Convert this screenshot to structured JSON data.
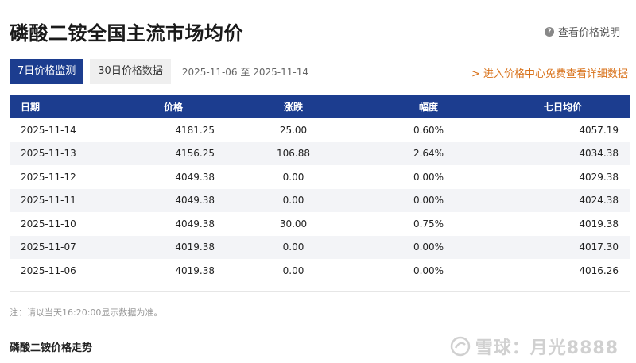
{
  "page": {
    "title": "磷酸二铵全国主流市场均价",
    "help_label": "查看价格说明"
  },
  "tabs": [
    {
      "label": "7日价格监测",
      "active": true
    },
    {
      "label": "30日价格数据",
      "active": false
    }
  ],
  "range": {
    "start": "2025-11-06",
    "sep": "至",
    "end": "2025-11-14"
  },
  "promo": "> 进入价格中心免费查看详细数据",
  "table": {
    "headers": [
      "日期",
      "价格",
      "涨跌",
      "幅度",
      "七日均价"
    ],
    "rows": [
      [
        "2025-11-14",
        "4181.25",
        "25.00",
        "0.60%",
        "4057.19"
      ],
      [
        "2025-11-13",
        "4156.25",
        "106.88",
        "2.64%",
        "4034.38"
      ],
      [
        "2025-11-12",
        "4049.38",
        "0.00",
        "0.00%",
        "4029.38"
      ],
      [
        "2025-11-11",
        "4049.38",
        "0.00",
        "0.00%",
        "4024.38"
      ],
      [
        "2025-11-10",
        "4049.38",
        "30.00",
        "0.75%",
        "4019.38"
      ],
      [
        "2025-11-07",
        "4019.38",
        "0.00",
        "0.00%",
        "4017.30"
      ],
      [
        "2025-11-06",
        "4019.38",
        "0.00",
        "0.00%",
        "4016.26"
      ]
    ]
  },
  "note": "注：请以当天16:20:00显示数据为准。",
  "trend_title": "磷酸二铵价格走势",
  "watermark": "雪球：月光8888",
  "colors": {
    "primary": "#1c3d8f",
    "accent_orange": "#d9731c",
    "pct_up": "#c0392b",
    "pct_zero": "#999999"
  }
}
